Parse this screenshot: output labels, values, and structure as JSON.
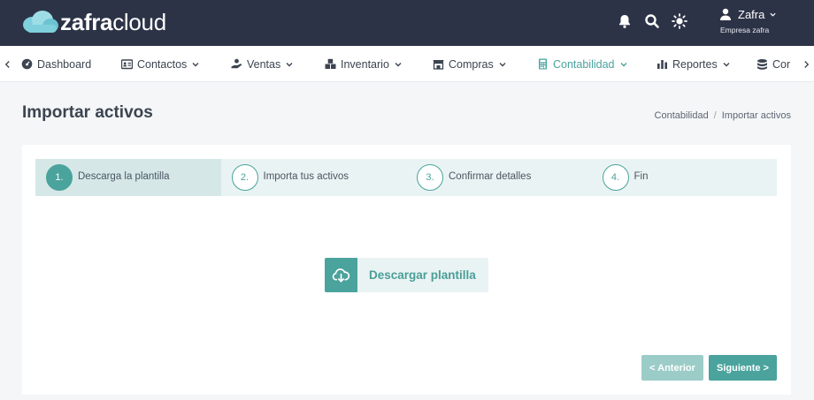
{
  "brand": {
    "part1": "zafra",
    "part2": "cloud"
  },
  "topbar": {
    "icons": [
      "bell-icon",
      "search-icon",
      "sun-icon"
    ],
    "user": {
      "name": "Zafra",
      "company": "Empresa zafra"
    }
  },
  "nav": {
    "items": [
      {
        "label": "Dashboard",
        "icon": "dashboard-icon",
        "dropdown": false
      },
      {
        "label": "Contactos",
        "icon": "contacts-icon",
        "dropdown": true
      },
      {
        "label": "Ventas",
        "icon": "sales-icon",
        "dropdown": true
      },
      {
        "label": "Inventario",
        "icon": "inventory-icon",
        "dropdown": true
      },
      {
        "label": "Compras",
        "icon": "store-icon",
        "dropdown": true
      },
      {
        "label": "Contabilidad",
        "icon": "calculator-icon",
        "dropdown": true,
        "active": true
      },
      {
        "label": "Reportes",
        "icon": "chart-icon",
        "dropdown": true
      },
      {
        "label": "Cor",
        "icon": "database-icon",
        "dropdown": false
      }
    ]
  },
  "page": {
    "title": "Importar activos",
    "breadcrumb": [
      "Contabilidad",
      "Importar activos"
    ]
  },
  "wizard": {
    "steps": [
      {
        "number": "1.",
        "label": "Descarga la plantilla",
        "current": true
      },
      {
        "number": "2.",
        "label": "Importa tus activos",
        "current": false
      },
      {
        "number": "3.",
        "label": "Confirmar detalles",
        "current": false
      },
      {
        "number": "4.",
        "label": "Fin",
        "current": false
      }
    ],
    "download_label": "Descargar plantilla",
    "prev_label": "< Anterior",
    "next_label": "Siguiente >"
  },
  "colors": {
    "accent": "#4aa39c",
    "topbar": "#2d3347",
    "accent_light": "#e9f3f3"
  }
}
